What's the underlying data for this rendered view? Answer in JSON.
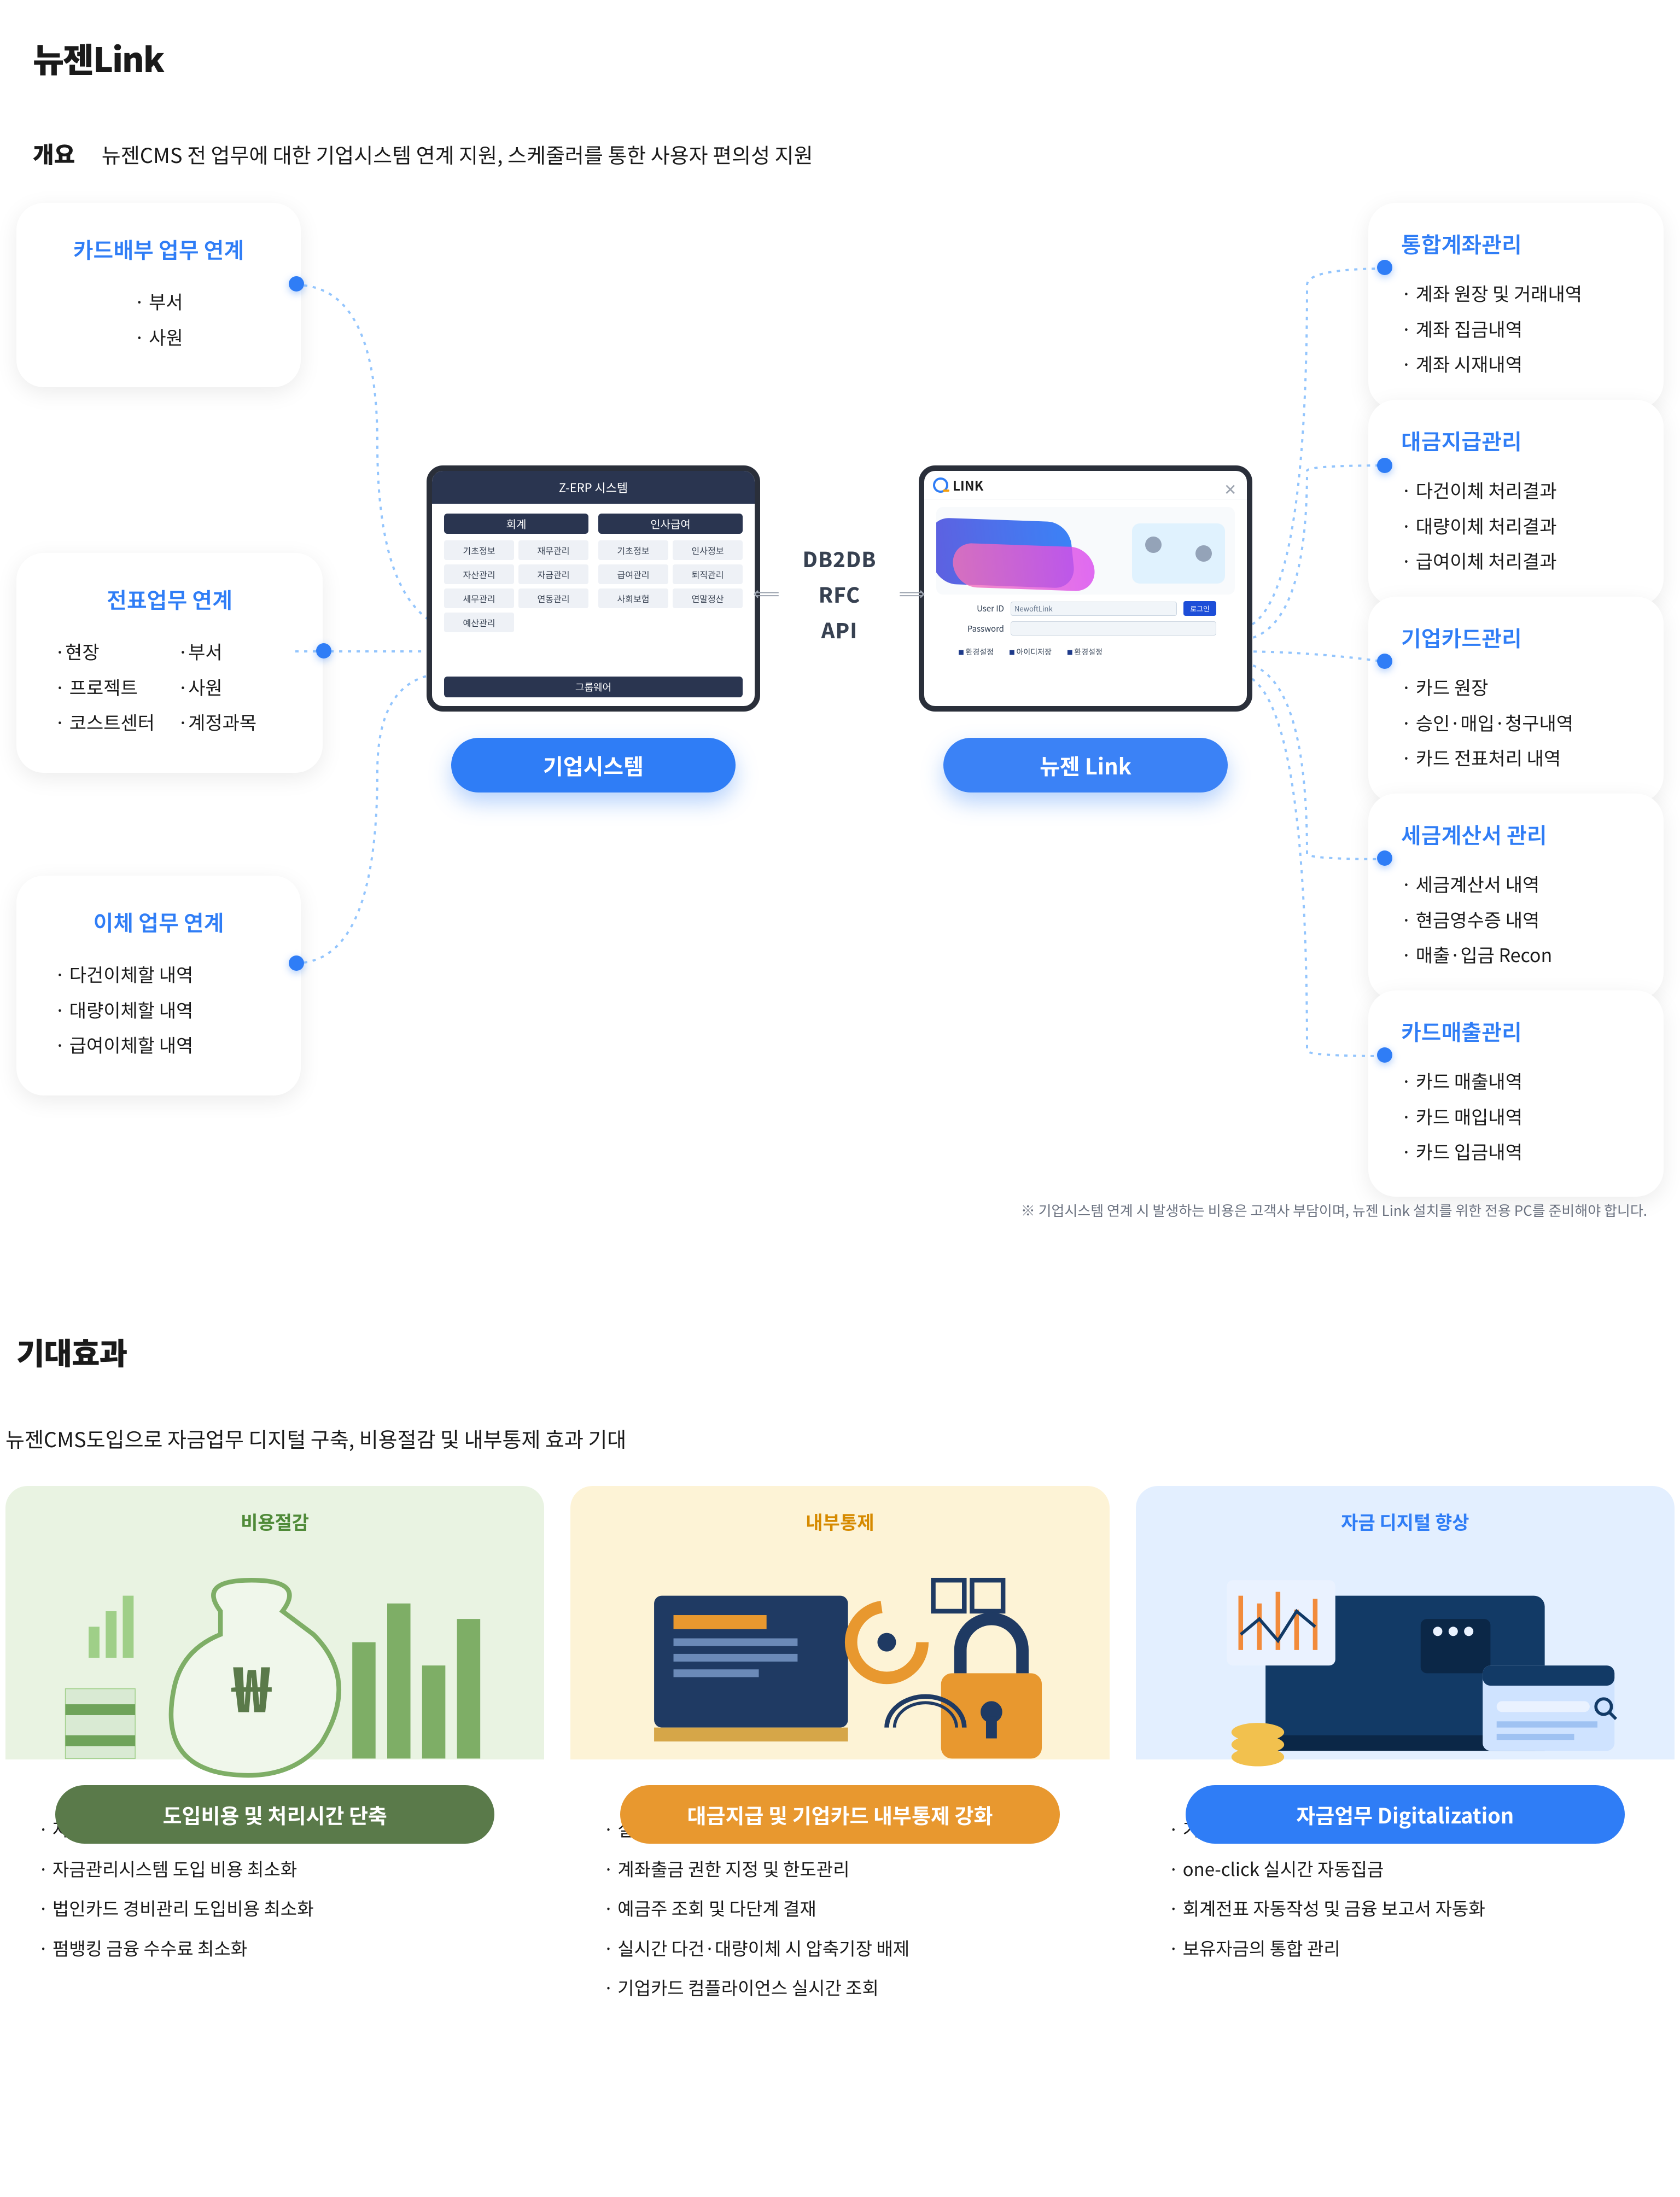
{
  "page": {
    "title": "뉴젠Link",
    "overview_label": "개요",
    "overview_text": "뉴젠CMS 전 업무에 대한 기업시스템 연계 지원, 스케줄러를 통한 사용자 편의성 지원"
  },
  "left_boxes": {
    "card_dispatch": {
      "title": "카드배부 업무 연계",
      "items": [
        "· 부서",
        "· 사원"
      ]
    },
    "voucher": {
      "title": "전표업무 연계",
      "items": [
        "·현장",
        "·부서",
        "· 프로젝트",
        "·사원",
        "· 코스트센터",
        "·계정과목"
      ]
    },
    "transfer": {
      "title": "이체 업무 연계",
      "items": [
        "· 다건이체할 내역",
        "· 대량이체할 내역",
        "· 급여이체할 내역"
      ]
    }
  },
  "right_boxes": {
    "acct": {
      "title": "통합계좌관리",
      "items": [
        "· 계좌 원장 및 거래내역",
        "· 계좌 집금내역",
        "· 계좌 시재내역"
      ]
    },
    "pay": {
      "title": "대금지급관리",
      "items": [
        "· 다건이체 처리결과",
        "· 대량이체 처리결과",
        "· 급여이체 처리결과"
      ]
    },
    "ccard": {
      "title": "기업카드관리",
      "items": [
        "· 카드 원장",
        "· 승인·매입·청구내역",
        "· 카드 전표처리 내역"
      ]
    },
    "tax": {
      "title": "세금계산서 관리",
      "items": [
        "· 세금계산서 내역",
        "· 현금영수증 내역",
        "· 매출·입금 Recon"
      ]
    },
    "sales": {
      "title": "카드매출관리",
      "items": [
        "· 카드 매출내역",
        "· 카드 매입내역",
        "· 카드 입금내역"
      ]
    }
  },
  "center": {
    "erp_title": "Z-ERP 시스템",
    "erp_subhead_left": "회계",
    "erp_subhead_right": "인사급여",
    "erp_left_cells": [
      "기초정보",
      "재무관리",
      "자산관리",
      "자금관리",
      "세무관리",
      "연동관리",
      "예산관리"
    ],
    "erp_right_cells": [
      "기초정보",
      "인사정보",
      "급여관리",
      "퇴직관리",
      "사회보험",
      "연말정산"
    ],
    "erp_foot": "그룹웨어",
    "pill_left": "기업시스템",
    "link_logo": "LINK",
    "link_close": "✕",
    "link_user_label": "User ID",
    "link_user_placeholder": "NewoftLink",
    "link_pw_label": "Password",
    "link_login": "로그인",
    "link_tab1": "환경설정",
    "link_tab2": "아이디저장",
    "link_tab3": "환경설정",
    "pill_right": "뉴젠 Link",
    "proto1": "DB2DB",
    "proto2": "RFC",
    "proto3": "API"
  },
  "footnote": "※ 기업시스템 연계 시 발생하는 비용은 고객사 부담이며, 뉴젠 Link 설치를 위한 전용 PC를 준비해야 합니다.",
  "effects": {
    "heading": "기대효과",
    "subtitle": "뉴젠CMS도입으로 자금업무 디지털 구축, 비용절감 및 내부통제 효과 기대",
    "cost": {
      "cat": "비용절감",
      "badge": "도입비용 및 처리시간 단축",
      "items": [
        "자금업무 자동화에 따른 처리시간 단축",
        "자금관리시스템 도입 비용 최소화",
        "법인카드 경비관리 도입비용 최소화",
        "펌뱅킹 금융 수수료 최소화"
      ]
    },
    "ctrl": {
      "cat": "내부통제",
      "badge": "대금지급 및 기업카드 내부통제 강화",
      "items": [
        "실시간 자금현황 모니터링",
        "계좌출금 권한 지정 및 한도관리",
        "예금주 조회 및 다단계 결재",
        "실시간 다건·대량이체 시 압축기장 배제",
        "기업카드 컴플라이언스 실시간 조회"
      ]
    },
    "digi": {
      "cat": "자금 디지털 향상",
      "badge": "자금업무 Digitalization",
      "items": [
        "기업시스템과 연계를 통한 업무 간소화",
        "one-click 실시간 자동집금",
        "회계전표 자동작성 및 금융 보고서 자동화",
        "보유자금의 통합 관리"
      ]
    }
  }
}
